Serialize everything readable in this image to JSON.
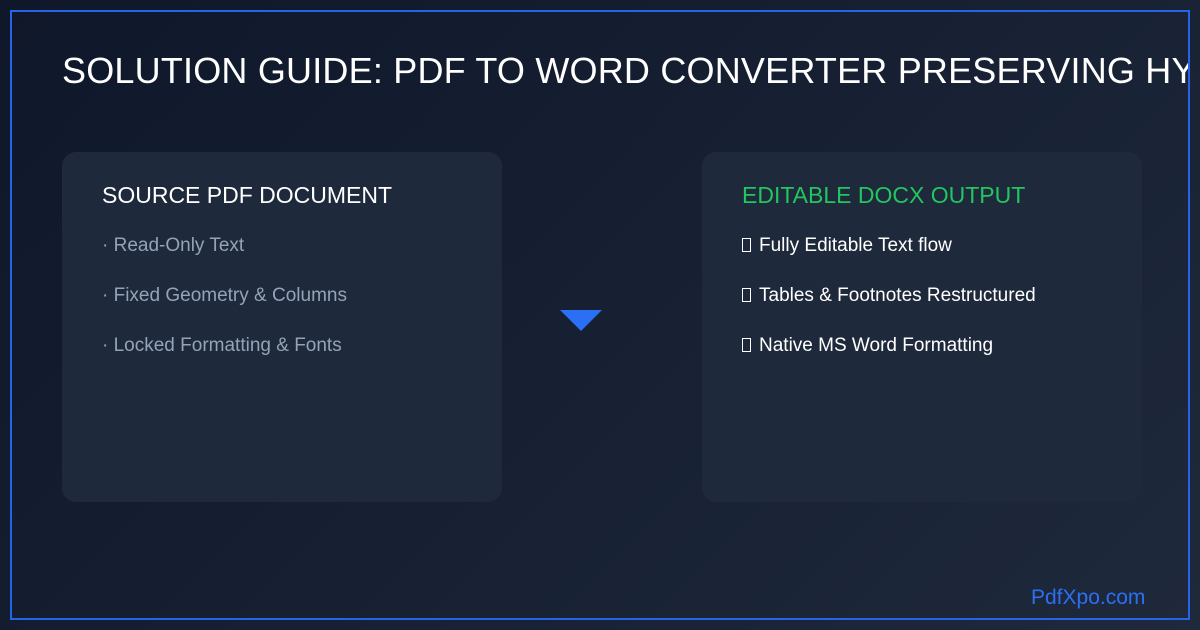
{
  "header": {
    "title": "SOLUTION GUIDE: PDF TO WORD CONVERTER PRESERVING HYPERLINKS"
  },
  "source_card": {
    "title": "SOURCE PDF DOCUMENT",
    "items": [
      "· Read-Only Text",
      "· Fixed Geometry & Columns",
      "· Locked Formatting & Fonts"
    ]
  },
  "output_card": {
    "title": "EDITABLE DOCX OUTPUT",
    "items": [
      "Fully Editable Text flow",
      "Tables & Footnotes Restructured",
      "Native MS Word Formatting"
    ]
  },
  "arrow_icon": "down-arrow-icon",
  "footer": {
    "brand": "PdfXpo.com"
  },
  "colors": {
    "background": "#0f172a",
    "frame_border": "#2563eb",
    "card_background": "#1e293b",
    "muted_text": "#94a3b8",
    "output_title": "#22c55e",
    "accent": "#2b6ff5"
  }
}
